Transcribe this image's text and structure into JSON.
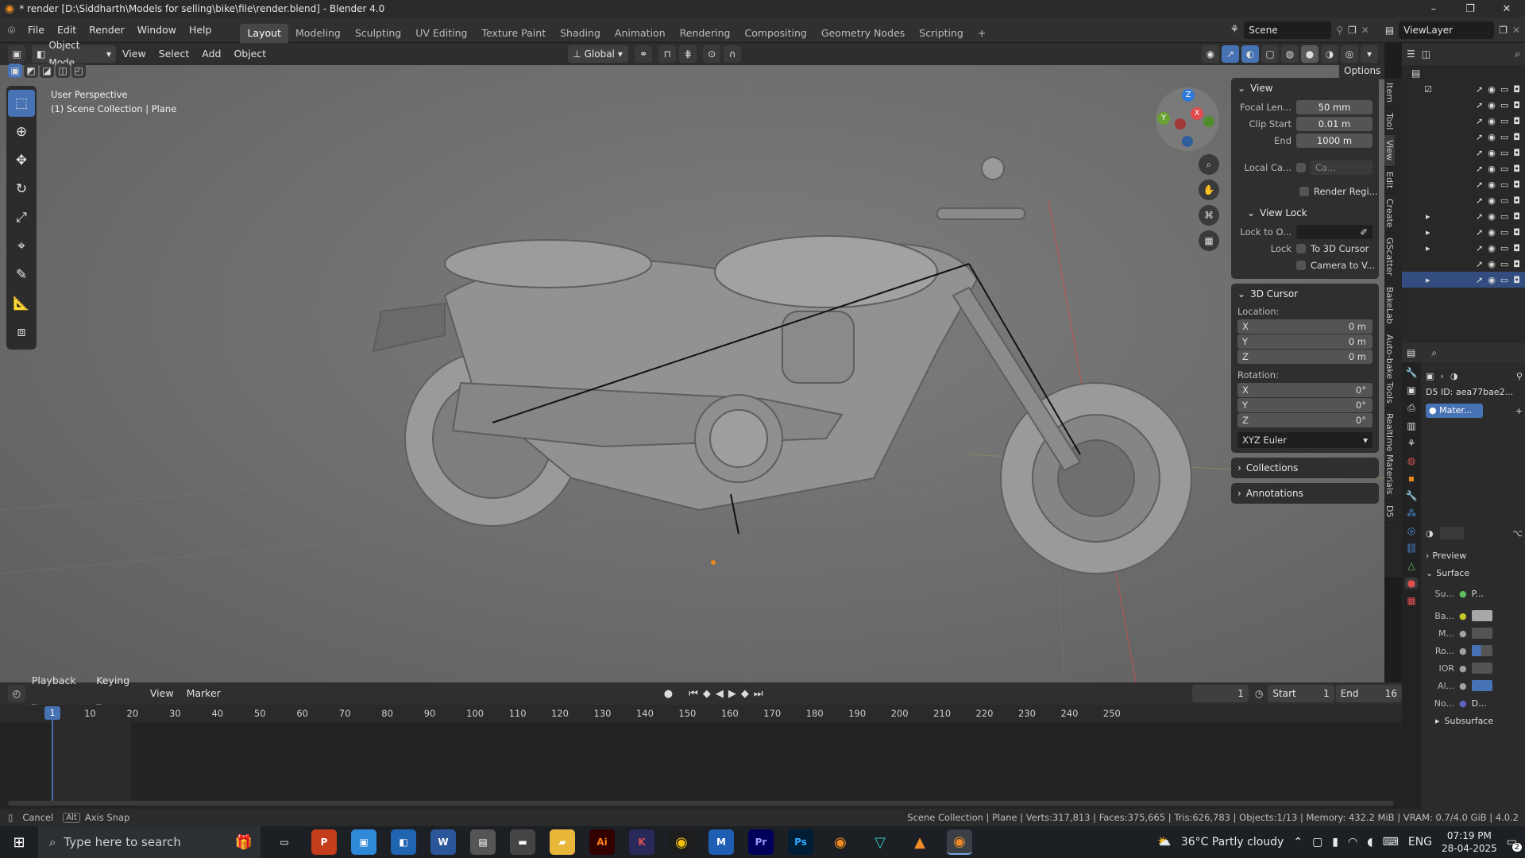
{
  "titlebar": {
    "title": "* render [D:\\Siddharth\\Models for selling\\bike\\file\\render.blend] - Blender 4.0",
    "minimize": "–",
    "maximize": "❐",
    "close": "✕"
  },
  "menu": {
    "items": [
      "File",
      "Edit",
      "Render",
      "Window",
      "Help"
    ]
  },
  "workspaces": {
    "tabs": [
      "Layout",
      "Modeling",
      "Sculpting",
      "UV Editing",
      "Texture Paint",
      "Shading",
      "Animation",
      "Rendering",
      "Compositing",
      "Geometry Nodes",
      "Scripting"
    ],
    "add": "+"
  },
  "scene": {
    "label": "Scene",
    "viewlayer": "ViewLayer"
  },
  "vphead": {
    "mode": "Object Mode",
    "menus": [
      "View",
      "Select",
      "Add",
      "Object"
    ],
    "orientation": "Global",
    "options": "Options"
  },
  "overlay": {
    "perspective": "User Perspective",
    "collection": "(1) Scene Collection | Plane"
  },
  "gizmo": {
    "z": "Z",
    "y": "Y",
    "x": "X"
  },
  "npanel": {
    "view": {
      "title": "View",
      "focal_label": "Focal Len...",
      "focal": "50 mm",
      "clip_start_label": "Clip Start",
      "clip_start": "0.01 m",
      "end_label": "End",
      "end": "1000 m",
      "local_cam_label": "Local Ca...",
      "local_cam": "Ca...",
      "render_region": "Render Regi...",
      "view_lock": "View Lock",
      "lock_to_label": "Lock to O...",
      "lock_label": "Lock",
      "to_cursor": "To 3D Cursor",
      "camera_to": "Camera to V..."
    },
    "cursor": {
      "title": "3D Cursor",
      "location": "Location:",
      "x_label": "X",
      "y_label": "Y",
      "z_label": "Z",
      "lx": "0 m",
      "ly": "0 m",
      "lz": "0 m",
      "rotation": "Rotation:",
      "rx": "0°",
      "ry": "0°",
      "rz": "0°",
      "euler": "XYZ Euler"
    },
    "collections": "Collections",
    "annotations": "Annotations"
  },
  "vtabs": [
    "Item",
    "Tool",
    "View",
    "Edit",
    "Create",
    "GScatter",
    "BakeLab",
    "Auto-bake Tools",
    "Realtime Materials",
    "D5"
  ],
  "props": {
    "id": "D5 ID: aea77bae2...",
    "material": "Mater...",
    "preview": "Preview",
    "surface": "Surface",
    "surface_label": "Su...",
    "surface_val": "P...",
    "inputs": [
      "Ba...",
      "M...",
      "Ro...",
      "IOR",
      "Al...",
      "No..."
    ],
    "normal_val": "D...",
    "subsurface": "Subsurface"
  },
  "timeline": {
    "menus": [
      "Playback",
      "Keying",
      "View",
      "Marker"
    ],
    "current": "1",
    "start_label": "Start",
    "start": "1",
    "end_label": "End",
    "end": "16",
    "ticks": [
      "1",
      "10",
      "20",
      "30",
      "40",
      "50",
      "60",
      "70",
      "80",
      "90",
      "100",
      "110",
      "120",
      "130",
      "140",
      "150",
      "160",
      "170",
      "180",
      "190",
      "200",
      "210",
      "220",
      "230",
      "240",
      "250"
    ]
  },
  "status": {
    "cancel": "Cancel",
    "alt": "Alt",
    "axis_snap": "Axis Snap",
    "stats": "Scene Collection | Plane | Verts:317,813 | Faces:375,665 | Tris:626,783 | Objects:1/13 | Memory: 432.2 MiB | VRAM: 0.7/4.0 GiB | 4.0.2"
  },
  "taskbar": {
    "search": "Type here to search",
    "weather": "36°C  Partly cloudy",
    "lang": "ENG",
    "time": "07:19 PM",
    "date": "28-04-2025",
    "notif": "2"
  }
}
